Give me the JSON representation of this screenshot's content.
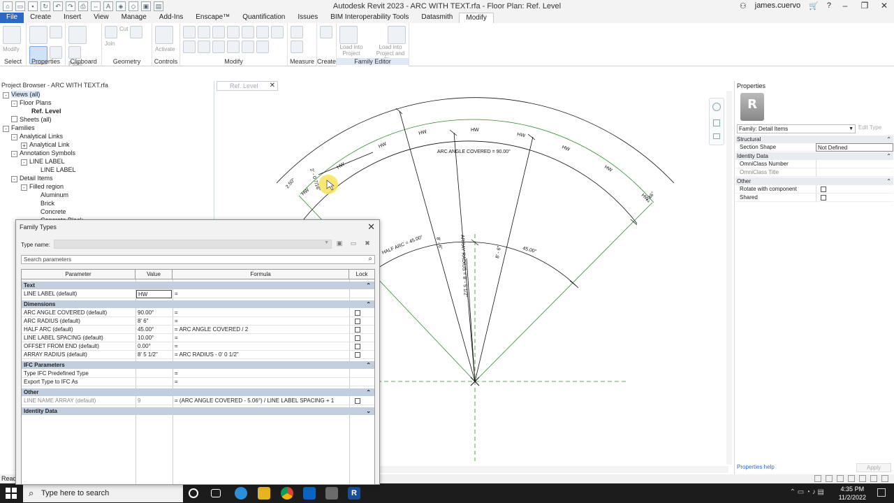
{
  "window": {
    "title": "Autodesk Revit 2023 - ARC WITH TEXT.rfa - Floor Plan: Ref. Level",
    "user": "james.cuervo"
  },
  "menu_tabs": [
    "File",
    "Create",
    "Insert",
    "View",
    "Manage",
    "Add-Ins",
    "Enscape™",
    "Quantification",
    "Issues",
    "BIM Interoperability Tools",
    "Datasmith",
    "Modify"
  ],
  "ribbon": {
    "buttons": {
      "modify": "Modify",
      "paste": "Paste",
      "cut": "Cut",
      "join": "Join",
      "activate": "Activate",
      "load_into_project": "Load into Project",
      "load_into_project_close": "Load into Project and Close"
    },
    "groups": [
      "Select",
      "Properties",
      "Clipboard",
      "Geometry",
      "Controls",
      "Modify",
      "Measure",
      "Create",
      "Family Editor"
    ]
  },
  "project_browser": {
    "title": "Project Browser - ARC WITH TEXT.rfa",
    "items": [
      {
        "label": "Views (all)",
        "toggle": "-"
      },
      {
        "label": "Floor Plans",
        "toggle": "-"
      },
      {
        "label": "Ref. Level",
        "toggle": ""
      },
      {
        "label": "Sheets (all)",
        "toggle": ""
      },
      {
        "label": "Families",
        "toggle": "-"
      },
      {
        "label": "Analytical Links",
        "toggle": "-"
      },
      {
        "label": "Analytical Link",
        "toggle": "+"
      },
      {
        "label": "Annotation Symbols",
        "toggle": "-"
      },
      {
        "label": "LINE LABEL",
        "toggle": "-"
      },
      {
        "label": "LINE LABEL",
        "toggle": ""
      },
      {
        "label": "Detail Items",
        "toggle": "-"
      },
      {
        "label": "Filled region",
        "toggle": "-"
      },
      {
        "label": "Aluminum",
        "toggle": ""
      },
      {
        "label": "Brick",
        "toggle": ""
      },
      {
        "label": "Concrete",
        "toggle": ""
      },
      {
        "label": "Concrete Block",
        "toggle": ""
      }
    ]
  },
  "view_tab": {
    "label": "Ref. Level"
  },
  "drawing": {
    "labels": {
      "arc_angle": "ARC ANGLE COVERED = 90.00°",
      "half_arc": "HALF ARC = 45.00°",
      "array_radius": "ARRAY RADIUS = 8' - 5 1/2\"",
      "arc_radius": "8' - 6\"",
      "angle45": "45.00°",
      "left_dim": "2' - 0 7/16\"",
      "left_angle": "2.50°",
      "right_angle": "2.46°",
      "line_text": "HW"
    }
  },
  "properties": {
    "title": "Properties",
    "icon_letter": "R",
    "family": "Family: Detail Items",
    "edit_type": "Edit Type",
    "sections": {
      "structural": "Structural",
      "identity": "Identity Data",
      "other": "Other"
    },
    "rows": {
      "section_shape": "Section Shape",
      "section_shape_value": "Not Defined",
      "omniclass_number": "OmniClass Number",
      "omniclass_title": "OmniClass Title",
      "rotate": "Rotate with component",
      "shared": "Shared"
    },
    "help": "Properties help",
    "apply": "Apply"
  },
  "status": {
    "text": "Ready"
  },
  "taskbar": {
    "search_placeholder": "Type here to search",
    "time": "4:35 PM",
    "date": "11/2/2022"
  },
  "family_types": {
    "title": "Family Types",
    "type_name_label": "Type name:",
    "search_placeholder": "Search parameters",
    "columns": [
      "Parameter",
      "Value",
      "Formula",
      "Lock"
    ],
    "sections": {
      "text": "Text",
      "dimensions": "Dimensions",
      "ifc": "IFC Parameters",
      "other": "Other",
      "identity": "Identity Data"
    },
    "text_rows": [
      {
        "param": "LINE LABEL (default)",
        "value": "HW",
        "formula": "=",
        "lock": false
      }
    ],
    "dimension_rows": [
      {
        "param": "ARC ANGLE COVERED (default)",
        "value": "90.00°",
        "formula": "=",
        "lock": true
      },
      {
        "param": "ARC RADIUS (default)",
        "value": "8'  6\"",
        "formula": "=",
        "lock": true
      },
      {
        "param": "HALF ARC (default)",
        "value": "45.00°",
        "formula": "= ARC ANGLE COVERED / 2",
        "lock": true
      },
      {
        "param": "LINE LABEL SPACING (default)",
        "value": "10.00°",
        "formula": "=",
        "lock": true
      },
      {
        "param": "OFFSET FROM END (default)",
        "value": "0.00°",
        "formula": "=",
        "lock": true
      },
      {
        "param": "ARRAY RADIUS (default)",
        "value": "8'  5 1/2\"",
        "formula": "= ARC RADIUS - 0'  0 1/2\"",
        "lock": true
      }
    ],
    "ifc_rows": [
      {
        "param": "Type IFC Predefined Type",
        "value": "",
        "formula": "=",
        "lock": false
      },
      {
        "param": "Export Type to IFC As",
        "value": "",
        "formula": "=",
        "lock": false
      }
    ],
    "other_rows": [
      {
        "param": "LINE NAME ARRAY (default)",
        "value": "9",
        "formula": "= (ARC ANGLE COVERED - 5.06°) / LINE LABEL SPACING + 1",
        "lock": true
      }
    ]
  }
}
